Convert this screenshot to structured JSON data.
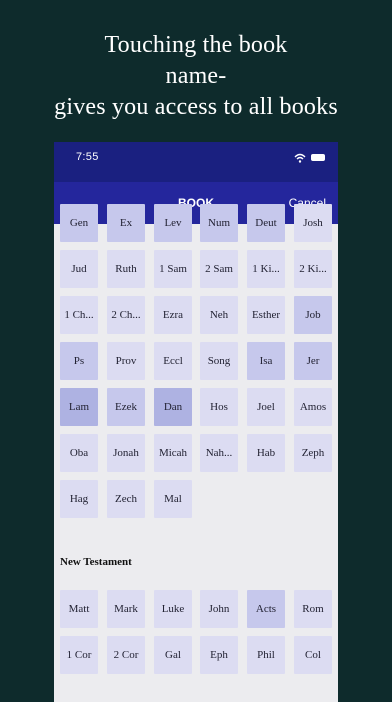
{
  "caption": {
    "line1": "Touching the book",
    "line2": "name-",
    "line3": "gives you access to all books"
  },
  "status_bar": {
    "time": "7:55"
  },
  "nav": {
    "title": "BOOK",
    "cancel_label": "Cancel"
  },
  "old_testament": [
    [
      "Gen",
      "Ex",
      "Lev",
      "Num",
      "Deut",
      "Josh"
    ],
    [
      "Jud",
      "Ruth",
      "1 Sam",
      "2 Sam",
      "1 Ki...",
      "2 Ki..."
    ],
    [
      "1 Ch...",
      "2 Ch...",
      "Ezra",
      "Neh",
      "Esther",
      "Job"
    ],
    [
      "Ps",
      "Prov",
      "Eccl",
      "Song",
      "Isa",
      "Jer"
    ],
    [
      "Lam",
      "Ezek",
      "Dan",
      "Hos",
      "Joel",
      "Amos"
    ],
    [
      "Oba",
      "Jonah",
      "Micah",
      "Nah...",
      "Hab",
      "Zeph"
    ],
    [
      "Hag",
      "Zech",
      "Mal"
    ]
  ],
  "old_testament_tones": [
    [
      "mid",
      "mid",
      "mid",
      "mid",
      "mid",
      "light"
    ],
    [
      "light",
      "light",
      "light",
      "light",
      "light",
      "light"
    ],
    [
      "light",
      "light",
      "light",
      "light",
      "light",
      "mid"
    ],
    [
      "mid",
      "light",
      "light",
      "light",
      "mid",
      "mid"
    ],
    [
      "dark",
      "mid",
      "dark",
      "light",
      "light",
      "light"
    ],
    [
      "light",
      "light",
      "light",
      "light",
      "light",
      "light"
    ],
    [
      "light",
      "light",
      "light"
    ]
  ],
  "new_testament_label": "New Testament",
  "new_testament": [
    [
      "Matt",
      "Mark",
      "Luke",
      "John",
      "Acts",
      "Rom"
    ],
    [
      "1 Cor",
      "2 Cor",
      "Gal",
      "Eph",
      "Phil",
      "Col"
    ]
  ],
  "new_testament_tones": [
    [
      "light",
      "light",
      "light",
      "light",
      "mid",
      "light"
    ],
    [
      "light",
      "light",
      "light",
      "light",
      "light",
      "light"
    ]
  ]
}
